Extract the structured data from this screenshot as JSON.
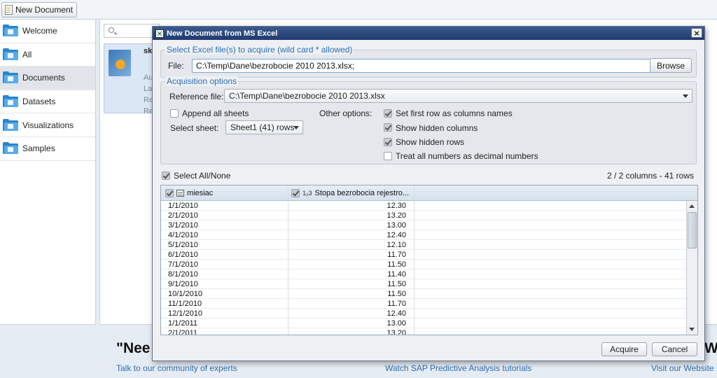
{
  "toolbar": {
    "new_document_label": "New Document"
  },
  "sidebar": {
    "items": [
      {
        "label": "Welcome"
      },
      {
        "label": "All"
      },
      {
        "label": "Documents"
      },
      {
        "label": "Datasets"
      },
      {
        "label": "Visualizations"
      },
      {
        "label": "Samples"
      }
    ]
  },
  "main": {
    "tile_name": "sk",
    "tile_meta": [
      "Au",
      "La",
      "Re",
      "Re"
    ]
  },
  "banner": {
    "headline": "\"Nee",
    "headline_right": "W",
    "links": [
      "Talk to our community of experts",
      "Watch SAP Predictive Analysis tutorials",
      "Visit our Website"
    ]
  },
  "dialog": {
    "title": "New Document from MS Excel",
    "close_glyph": "×",
    "files_group": {
      "legend": "Select Excel file(s) to acquire (wild card * allowed)",
      "file_label": "File:",
      "file_value": "C:\\Temp\\Dane\\bezrobocie 2010 2013.xlsx;",
      "browse_label": "Browse"
    },
    "options_group": {
      "legend": "Acquisition options",
      "reference_label": "Reference file:",
      "reference_value": "C:\\Temp\\Dane\\bezrobocie 2010 2013.xlsx",
      "append_sheets_label": "Append all sheets",
      "append_sheets_checked": false,
      "select_sheet_label": "Select sheet:",
      "sheet_value": "Sheet1 (41) rows",
      "other_options_label": "Other options:",
      "options": [
        {
          "label": "Set first row as columns names",
          "checked": true
        },
        {
          "label": "Show hidden columns",
          "checked": true
        },
        {
          "label": "Show hidden rows",
          "checked": true
        },
        {
          "label": "Treat all numbers as decimal numbers",
          "checked": false
        }
      ]
    },
    "select_all_label": "Select All/None",
    "select_all_checked": true,
    "summary": "2 / 2 columns - 41 rows",
    "columns": [
      {
        "name": "miesiac",
        "type_badge": ""
      },
      {
        "name": "Stopa bezrobocia rejestro...",
        "type_badge": "1₂3"
      }
    ],
    "rows": [
      [
        "1/1/2010",
        "12.30"
      ],
      [
        "2/1/2010",
        "13.20"
      ],
      [
        "3/1/2010",
        "13.00"
      ],
      [
        "4/1/2010",
        "12.40"
      ],
      [
        "5/1/2010",
        "12.10"
      ],
      [
        "6/1/2010",
        "11.70"
      ],
      [
        "7/1/2010",
        "11.50"
      ],
      [
        "8/1/2010",
        "11.40"
      ],
      [
        "9/1/2010",
        "11.50"
      ],
      [
        "10/1/2010",
        "11.50"
      ],
      [
        "11/1/2010",
        "11.70"
      ],
      [
        "12/1/2010",
        "12.40"
      ],
      [
        "1/1/2011",
        "13.00"
      ],
      [
        "2/1/2011",
        "13.20"
      ]
    ],
    "acquire_label": "Acquire",
    "cancel_label": "Cancel"
  }
}
